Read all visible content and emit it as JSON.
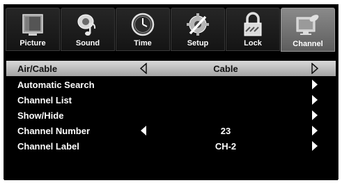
{
  "tabs": [
    {
      "label": "Picture",
      "icon": "monitor-icon",
      "active": false
    },
    {
      "label": "Sound",
      "icon": "speaker-note-icon",
      "active": false
    },
    {
      "label": "Time",
      "icon": "clock-icon",
      "active": false
    },
    {
      "label": "Setup",
      "icon": "gear-wrench-icon",
      "active": false
    },
    {
      "label": "Lock",
      "icon": "padlock-icon",
      "active": false
    },
    {
      "label": "Channel",
      "icon": "satellite-monitor-icon",
      "active": true
    }
  ],
  "menu": {
    "rows": [
      {
        "label": "Air/Cable",
        "value": "Cable",
        "selected": true,
        "left_arrow": true,
        "right_arrow": true
      },
      {
        "label": "Automatic Search",
        "value": "",
        "selected": false,
        "left_arrow": false,
        "right_arrow": true
      },
      {
        "label": "Channel List",
        "value": "",
        "selected": false,
        "left_arrow": false,
        "right_arrow": true
      },
      {
        "label": "Show/Hide",
        "value": "",
        "selected": false,
        "left_arrow": false,
        "right_arrow": true
      },
      {
        "label": "Channel Number",
        "value": "23",
        "selected": false,
        "left_arrow": true,
        "right_arrow": true
      },
      {
        "label": "Channel Label",
        "value": "CH-2",
        "selected": false,
        "left_arrow": false,
        "right_arrow": true
      }
    ]
  },
  "colors": {
    "background": "#000000",
    "selected_row": "#b8b8b8",
    "active_tab": "#7a7a7a",
    "text": "#ffffff"
  }
}
